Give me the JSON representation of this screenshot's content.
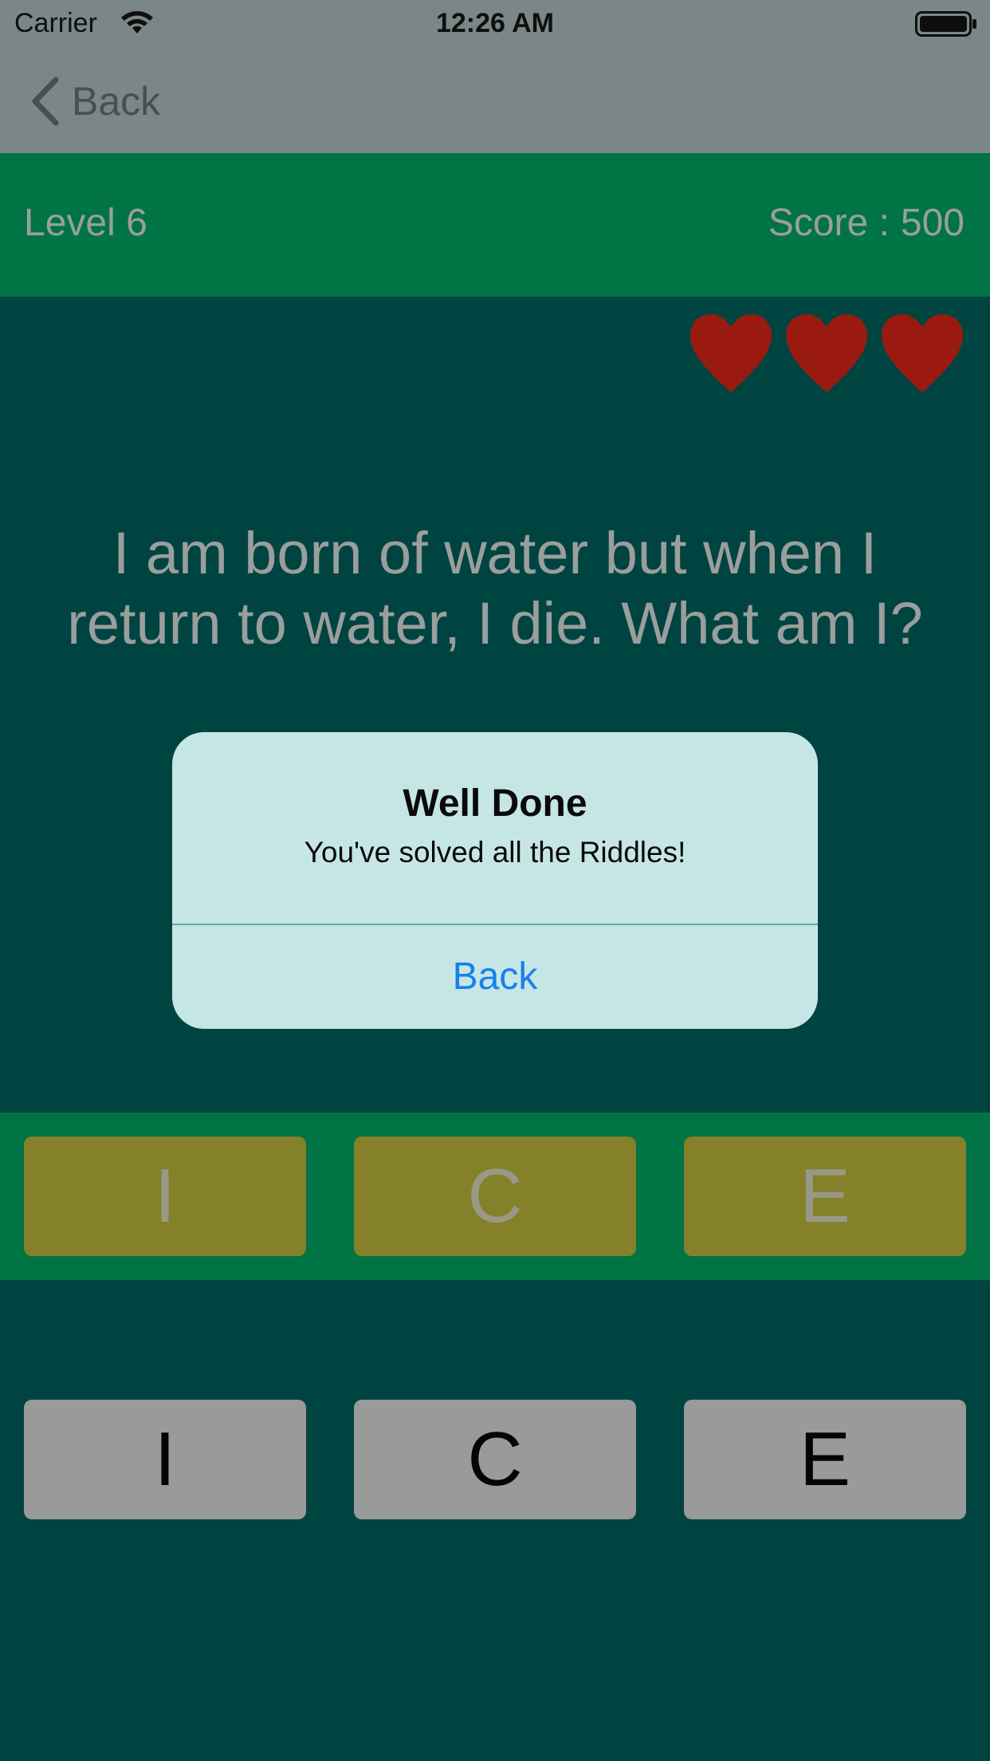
{
  "status_bar": {
    "carrier": "Carrier",
    "time": "12:26 AM"
  },
  "nav": {
    "back_label": "Back"
  },
  "header": {
    "level": "Level 6",
    "score_label": "Score :",
    "score_value": "500"
  },
  "lives": {
    "count": 3,
    "icon": "heart-icon",
    "color": "#9a1a10"
  },
  "riddle": {
    "text": "I am born of water but when I return to water, I die. What am I?"
  },
  "answer_tiles": [
    "I",
    "C",
    "E"
  ],
  "letter_tiles": [
    "I",
    "C",
    "E"
  ],
  "alert": {
    "title": "Well Done",
    "message": "You've solved all the Riddles!",
    "button_label": "Back"
  },
  "colors": {
    "background": "#004442",
    "band": "#007445",
    "answer_tile": "#85802a",
    "letter_tile": "#9a9a9a",
    "alert_background": "#c6e6e5",
    "alert_button": "#1a7ff0"
  }
}
